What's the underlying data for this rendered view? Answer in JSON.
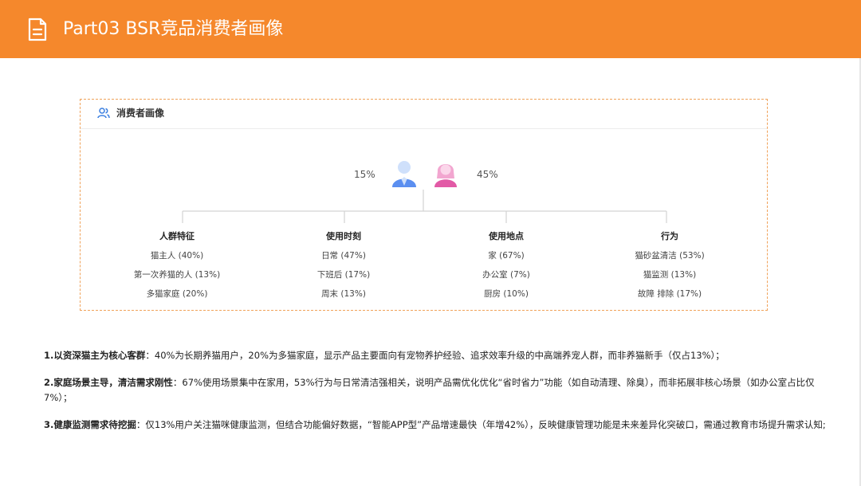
{
  "header": {
    "title": "Part03 BSR竞品消费者画像",
    "icon": "document-icon",
    "background": "#f5882c"
  },
  "panel": {
    "title": "消费者画像",
    "icon": "users-icon",
    "gender": {
      "male_percent": "15%",
      "female_percent": "45%",
      "male_color": "#5b8ff0",
      "female_color": "#e25aa6"
    },
    "columns": [
      {
        "title": "人群特征",
        "items": [
          "猫主人 (40%)",
          "第一次养猫的人 (13%)",
          "多猫家庭 (20%)"
        ]
      },
      {
        "title": "使用时刻",
        "items": [
          "日常 (47%)",
          "下班后 (17%)",
          "周末 (13%)"
        ]
      },
      {
        "title": "使用地点",
        "items": [
          "家 (67%)",
          "办公室 (7%)",
          "厨房 (10%)"
        ]
      },
      {
        "title": "行为",
        "items": [
          "猫砂盆清洁 (53%)",
          "猫监测 (13%)",
          "故障 排除 (17%)"
        ]
      }
    ]
  },
  "notes": [
    {
      "lead": "1.以资深猫主为核心客群",
      "text": "：40%为长期养猫用户，20%为多猫家庭，显示产品主要面向有宠物养护经验、追求效率升级的中高端养宠人群，而非养猫新手（仅占13%）；"
    },
    {
      "lead": "2.家庭场景主导，清洁需求刚性",
      "text": "：67%使用场景集中在家用，53%行为与日常清洁强相关，说明产品需优化优化“省时省力”功能（如自动清理、除臭），而非拓展非核心场景（如办公室占比仅7%）；"
    },
    {
      "lead": "3.健康监测需求待挖掘",
      "text": "：仅13%用户关注猫咪健康监测，但结合功能偏好数据，“智能APP型”产品增速最快（年增42%），反映健康管理功能是未来差异化突破口，需通过教育市场提升需求认知;"
    }
  ]
}
